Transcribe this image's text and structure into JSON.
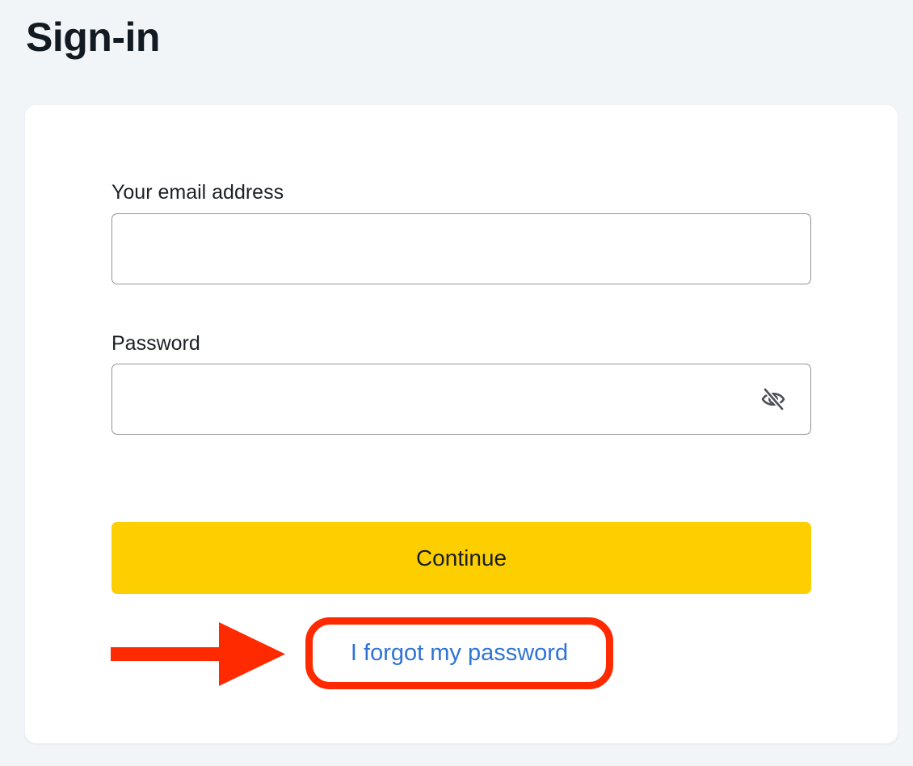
{
  "page": {
    "title": "Sign-in"
  },
  "form": {
    "email_label": "Your email address",
    "email_value": "",
    "password_label": "Password",
    "password_value": "",
    "password_toggle_icon": "eye-slash-icon",
    "continue_label": "Continue",
    "forgot_password_label": "I forgot my password"
  },
  "annotation": {
    "arrow_icon": "arrow-right-icon",
    "highlight": "forgot-password-link"
  },
  "colors": {
    "page_background": "#f2f5f8",
    "card_background": "#ffffff",
    "primary_button": "#fdcf00",
    "link": "#2f73d6",
    "annotation": "#ff2a00",
    "input_border": "#8f9499"
  }
}
